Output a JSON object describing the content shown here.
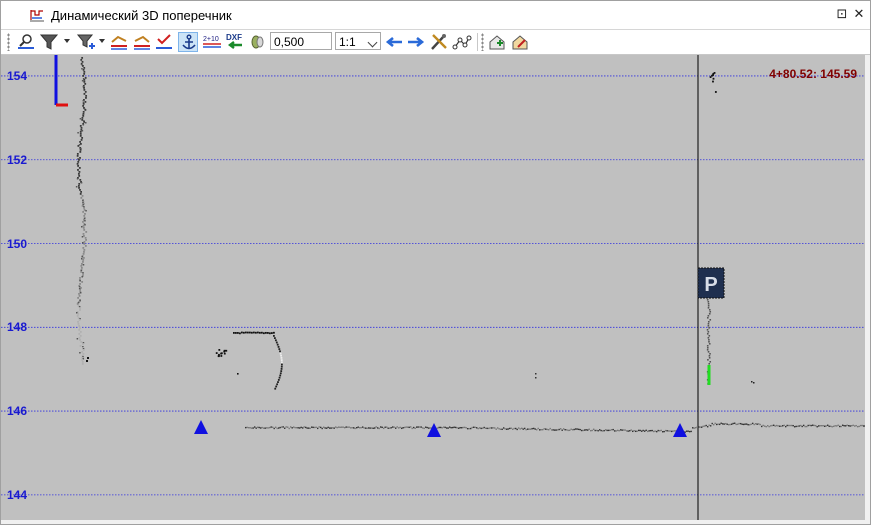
{
  "window": {
    "title": "Динамический 3D поперечник",
    "pin_glyph": "⊡",
    "close_glyph": "✕"
  },
  "toolbar": {
    "step_value": "0,500",
    "scale_value": "1:1",
    "scale_icon_text": "2+10",
    "dxf_icon_text": "DXF"
  },
  "view": {
    "readout": "4+80.52: 145.59",
    "y_axis": {
      "min": 143.4,
      "max": 154.5,
      "ticks": [
        {
          "value": 154,
          "label": "154"
        },
        {
          "value": 152,
          "label": "152"
        },
        {
          "value": 150,
          "label": "150"
        },
        {
          "value": 148,
          "label": "148"
        },
        {
          "value": 146,
          "label": "146"
        },
        {
          "value": 144,
          "label": "144"
        }
      ]
    },
    "sign_letter": "P",
    "colors": {
      "background": "#c0c0c0",
      "gridline": "#3030e0",
      "axis_label": "#1a1ad0",
      "readout": "#800000",
      "marker": "#1010e0",
      "axis_vertical": "#1010e0",
      "axis_horizontal": "#e01010",
      "sign_fill": "#1f2f4f",
      "green_segment": "#22dd22"
    }
  }
}
